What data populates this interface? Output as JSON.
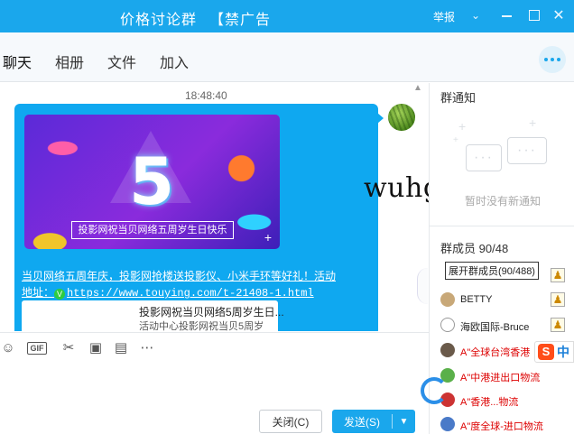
{
  "window": {
    "title": "价格讨论群",
    "title_tag": "【禁广告",
    "report": "举报",
    "chevron": "⌄",
    "close": "✕"
  },
  "tabs": [
    "聊天",
    "相册",
    "文件",
    "加入"
  ],
  "chat": {
    "timestamp": "18:48:40",
    "banner": {
      "big": "5",
      "caption": "投影网祝当贝网络五周岁生日快乐",
      "plus": "+"
    },
    "message_line1": "当贝网络五周年庆，投影网抢楼送投影仪、小米手环等好礼！活动",
    "message_prefix": "地址：",
    "wechat_mark": "V",
    "message_link": "https://www.touying.com/t-21408-1.html",
    "card_title": "投影网祝当贝网络5周岁生日...",
    "card_subtitle": "活动中心投影网祝当贝5周岁"
  },
  "watermark": "wuhg",
  "toolbar": {
    "emoji": "☺",
    "gif": "GIF",
    "scissors": "✂",
    "image": "▣",
    "file": "▤",
    "more": "⋯"
  },
  "input": {
    "close_label": "关闭(C)",
    "send_label": "发送(S)",
    "send_arrow": "▼"
  },
  "right_panel": {
    "notice_title": "群通知",
    "notice_empty": "暂时没有新通知",
    "members_title": "群成员",
    "members_count": "90/48",
    "tooltip": "展开群成员(90/488)",
    "members": [
      {
        "name": "BETTY",
        "red": false
      },
      {
        "name": "海欧国际-Bruce",
        "red": false
      },
      {
        "name": "A\"全球台湾香港",
        "red": true
      },
      {
        "name": "A\"中港进出口物流",
        "red": true
      },
      {
        "name": "A\"香港...物流",
        "red": true
      },
      {
        "name": "A\"度全球-进口物流",
        "red": true
      }
    ],
    "owner_icon": "♟"
  },
  "ime": {
    "s": "S",
    "zh": "中"
  }
}
